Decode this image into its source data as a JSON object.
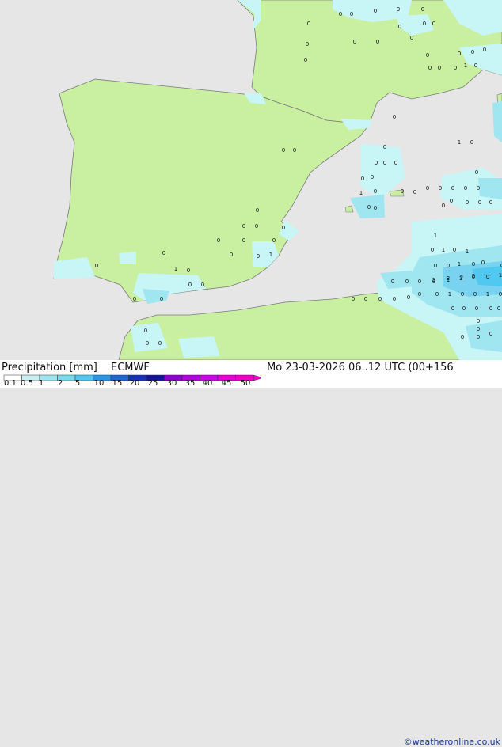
{
  "footer": {
    "title": "Precipitation [mm]",
    "model": "ECMWF",
    "datetime": "Mo 23-03-2026 06..12 UTC (00+156",
    "credit": "©weatheronline.co.uk"
  },
  "legend": {
    "tick_labels": [
      "0.1",
      "0.5",
      "1",
      "2",
      "5",
      "10",
      "15",
      "20",
      "25",
      "30",
      "35",
      "40",
      "45",
      "50"
    ],
    "colors": [
      "#ffffff",
      "#c8f0f0",
      "#a0e6f0",
      "#78dcf0",
      "#50c8f0",
      "#2896e6",
      "#1e64d2",
      "#1432be",
      "#1414a0",
      "#8c00d2",
      "#b400e6",
      "#d200f0",
      "#e600dc",
      "#f000c8"
    ]
  },
  "map_colors": {
    "sea": "#e6e6e6",
    "land_precip_free": "#e6e6e6",
    "land_dry": "#c8f0a0",
    "light_precip": "#c8f5f5",
    "moderate_precip": "#a0e6f0",
    "heavier_precip": "#78d2f0",
    "coast": "#7a7a7a"
  },
  "values": {
    "france": [
      "0",
      "0",
      "0",
      "0",
      "0",
      "0",
      "0",
      "0",
      "0",
      "0",
      "0",
      "0",
      "0",
      "0",
      "0",
      "0",
      "0",
      "0",
      "0",
      "0",
      "1",
      "0",
      "0"
    ],
    "iberia": [
      "0",
      "0",
      "0",
      "0",
      "0",
      "0",
      "0",
      "0",
      "0",
      "0",
      "0",
      "0",
      "1",
      "0",
      "1",
      "0",
      "0",
      "0",
      "0",
      "0",
      "0"
    ],
    "balearic": [
      "1",
      "0",
      "0",
      "0",
      "0",
      "0",
      "0",
      "0",
      "0",
      "1",
      "0"
    ],
    "mediterranean_east": [
      "0",
      "0",
      "0",
      "0",
      "0",
      "0",
      "0",
      "0",
      "0",
      "0",
      "0",
      "0",
      "0",
      "0"
    ],
    "algeria_sea": [
      "0",
      "0",
      "0",
      "0",
      "1",
      "1",
      "0",
      "0",
      "1",
      "0",
      "0",
      "1",
      "3",
      "2",
      "2",
      "1",
      "0",
      "0",
      "1",
      "0",
      "0",
      "1",
      "0",
      "0",
      "0",
      "0",
      "0",
      "0",
      "0",
      "0",
      "0",
      "1",
      "0",
      "1",
      "0",
      "0",
      "0",
      "0",
      "0",
      "1"
    ],
    "north_africa": [
      "0",
      "0",
      "0",
      "0",
      "0",
      "0",
      "0",
      "0",
      "0"
    ]
  }
}
